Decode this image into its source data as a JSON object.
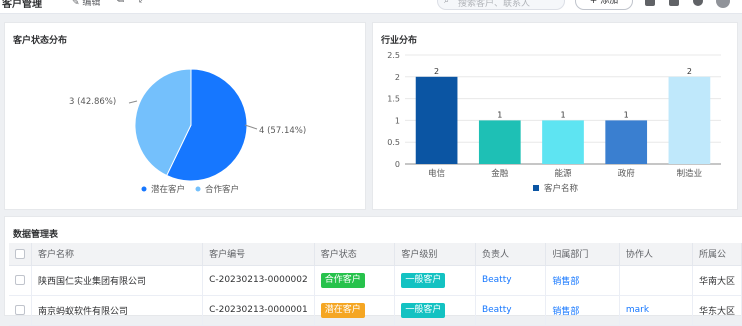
{
  "topbar": {
    "breadcrumb": "客户管理",
    "edit_label": "编辑",
    "search_placeholder": "搜索客户、联系人",
    "add_button": "+ 添加",
    "colors": {
      "primary": "#1677ff"
    }
  },
  "pie": {
    "title": "客户状态分布",
    "legend": [
      "潜在客户",
      "合作客户"
    ],
    "label_potential": "4 (57.14%)",
    "label_partner": "3 (42.86%)"
  },
  "bar": {
    "title": "行业分布",
    "legend": "客户名称"
  },
  "chart_data": [
    {
      "type": "pie",
      "title": "客户状态分布",
      "categories": [
        "潜在客户",
        "合作客户"
      ],
      "values": [
        4,
        3
      ],
      "percent": [
        57.14,
        42.86
      ],
      "colors": [
        "#1677ff",
        "#74c0fc"
      ],
      "legend_position": "bottom"
    },
    {
      "type": "bar",
      "title": "行业分布",
      "categories": [
        "电信",
        "金融",
        "能源",
        "政府",
        "制造业"
      ],
      "series": [
        {
          "name": "客户名称",
          "values": [
            2,
            1,
            1,
            1,
            2
          ]
        }
      ],
      "colors": [
        "#0b55a3",
        "#1ec0b5",
        "#5ee4f2",
        "#3a7fd0",
        "#bfe8fb"
      ],
      "yticks": [
        "0",
        "0.5",
        "1",
        "1.5",
        "2",
        "2.5"
      ],
      "ylim": [
        0,
        2.5
      ],
      "grid": true,
      "legend_position": "bottom"
    }
  ],
  "table": {
    "title": "数据管理表",
    "columns": [
      "客户名称",
      "客户编号",
      "客户状态",
      "客户级别",
      "负责人",
      "归属部门",
      "协作人",
      "所属公"
    ],
    "rows": [
      {
        "name": "陕西国仁实业集团有限公司",
        "code": "C-20230213-0000002",
        "status": "合作客户",
        "level": "一般客户",
        "owner": "Beatty",
        "dept": "销售部",
        "collab": "",
        "company": "华南大区"
      },
      {
        "name": "南京蚂蚁软件有限公司",
        "code": "C-20230213-0000001",
        "status": "潜在客户",
        "level": "一般客户",
        "owner": "Beatty",
        "dept": "销售部",
        "collab": "mark",
        "company": "华东大区"
      }
    ]
  }
}
